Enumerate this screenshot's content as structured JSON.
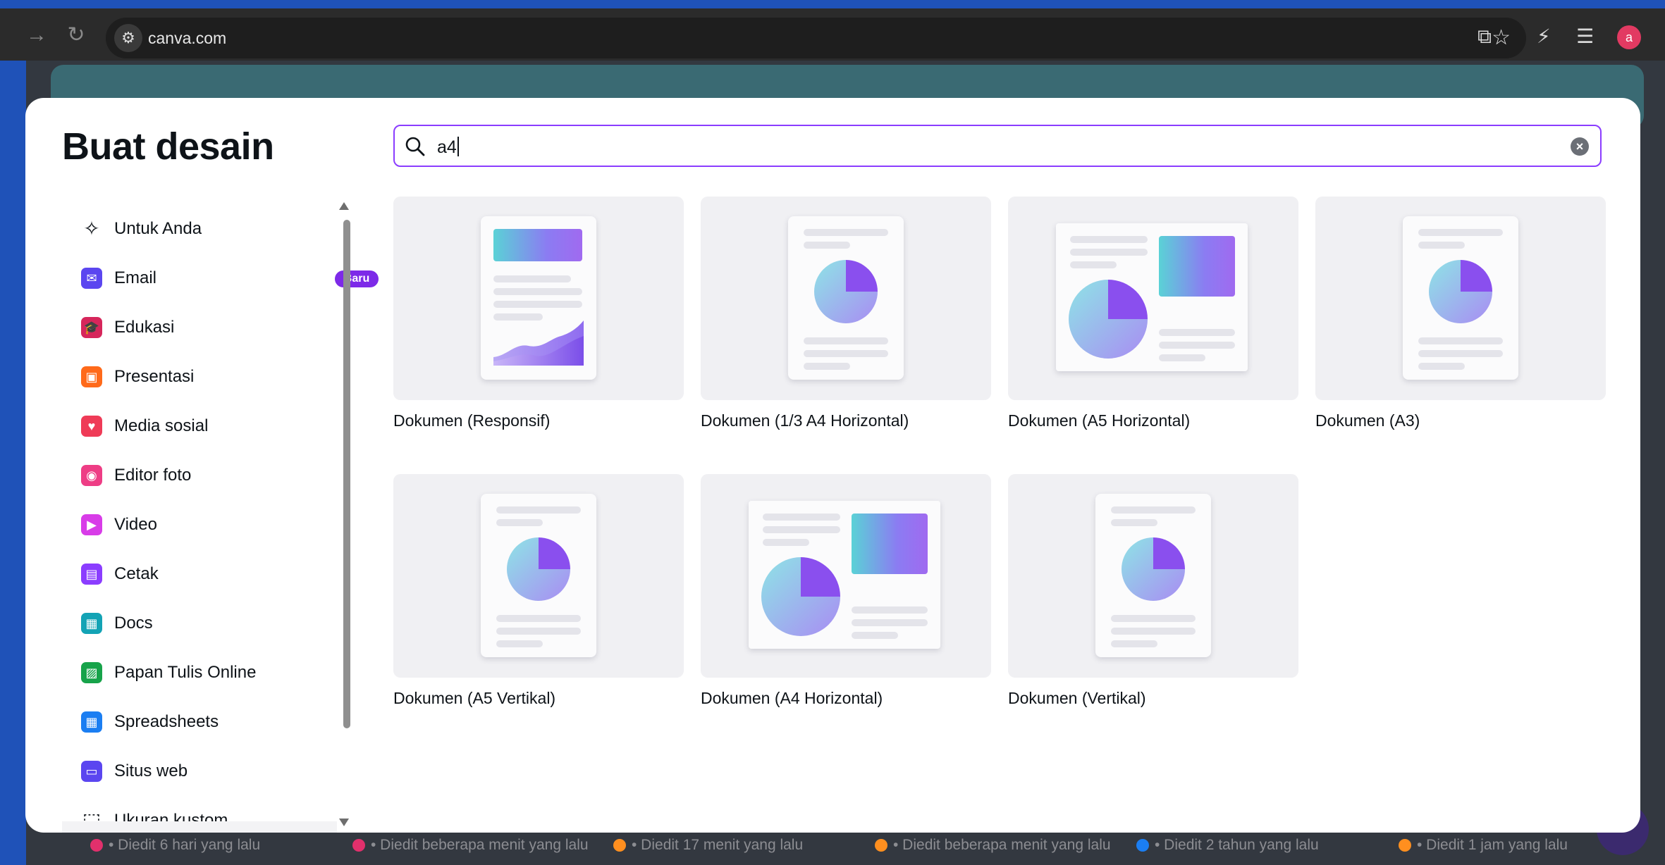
{
  "browser": {
    "url": "canva.com",
    "profile_initial": "a",
    "icons": [
      "forward-icon",
      "reload-icon",
      "site-settings-icon",
      "star-icon",
      "extensions-icon",
      "performance-icon",
      "reading-list-icon"
    ]
  },
  "background": {
    "status_items": [
      {
        "text": "• Diedit 6 hari yang lalu",
        "color": "#e1306c"
      },
      {
        "text": "• Diedit beberapa menit yang lalu",
        "color": "#e1306c"
      },
      {
        "text": "• Diedit 17 menit yang lalu",
        "color": "#ff8f1f"
      },
      {
        "text": "• Diedit beberapa menit yang lalu",
        "color": "#ff8f1f"
      },
      {
        "text": "• Diedit 2 tahun yang lalu",
        "color": "#1b7ef2"
      },
      {
        "text": "• Diedit 1 jam yang lalu",
        "color": "#ff8f1f"
      }
    ]
  },
  "modal": {
    "title": "Buat desain",
    "search": {
      "value": "a4",
      "placeholder": ""
    },
    "categories": [
      {
        "label": "Untuk Anda",
        "icon": "sparkle-icon",
        "color": "#0e1318"
      },
      {
        "label": "Email",
        "icon": "email-icon",
        "color": "#5b46f0",
        "badge": "Baru"
      },
      {
        "label": "Edukasi",
        "icon": "graduation-cap-icon",
        "color": "#d6265b"
      },
      {
        "label": "Presentasi",
        "icon": "presentation-icon",
        "color": "#ff6a1a"
      },
      {
        "label": "Media sosial",
        "icon": "heart-icon",
        "color": "#ef3b57"
      },
      {
        "label": "Editor foto",
        "icon": "camera-icon",
        "color": "#ee3d85"
      },
      {
        "label": "Video",
        "icon": "video-icon",
        "color": "#d83ce8"
      },
      {
        "label": "Cetak",
        "icon": "printer-icon",
        "color": "#8b3dff"
      },
      {
        "label": "Docs",
        "icon": "docs-icon",
        "color": "#13a3b5"
      },
      {
        "label": "Papan Tulis Online",
        "icon": "whiteboard-icon",
        "color": "#17a34a"
      },
      {
        "label": "Spreadsheets",
        "icon": "spreadsheet-icon",
        "color": "#1b7ef2"
      },
      {
        "label": "Situs web",
        "icon": "website-icon",
        "color": "#5b46f0"
      },
      {
        "label": "Ukuran kustom",
        "icon": "custom-size-icon",
        "color": "#0e1318"
      }
    ],
    "results": [
      {
        "label": "Dokumen (Responsif)",
        "thumb": "responsive"
      },
      {
        "label": "Dokumen (1/3 A4 Horizontal)",
        "thumb": "portrait-pie"
      },
      {
        "label": "Dokumen (A5 Horizontal)",
        "thumb": "landscape"
      },
      {
        "label": "Dokumen (A3)",
        "thumb": "portrait-pie"
      },
      {
        "label": "Dokumen (A5 Vertikal)",
        "thumb": "portrait-pie"
      },
      {
        "label": "Dokumen (A4 Horizontal)",
        "thumb": "landscape"
      },
      {
        "label": "Dokumen (Vertikal)",
        "thumb": "portrait-pie"
      }
    ]
  }
}
